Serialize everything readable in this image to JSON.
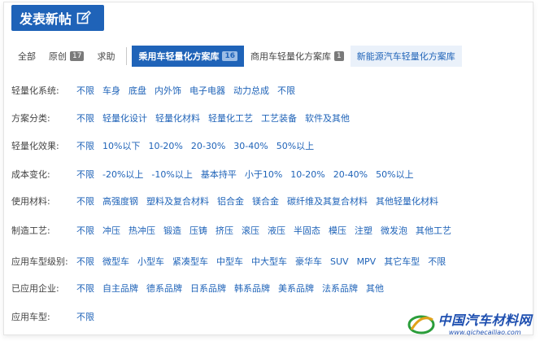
{
  "post_button": {
    "label": "发表新帖",
    "icon": "edit-icon"
  },
  "tabs": [
    {
      "label": "全部",
      "badge": "",
      "style": "plain"
    },
    {
      "label": "原创",
      "badge": "17",
      "style": "plain"
    },
    {
      "label": "求助",
      "badge": "",
      "style": "plain"
    },
    {
      "label": "乘用车轻量化方案库",
      "badge": "16",
      "style": "active"
    },
    {
      "label": "商用车轻量化方案库",
      "badge": "1",
      "style": "plain"
    },
    {
      "label": "新能源汽车轻量化方案库",
      "badge": "",
      "style": "light"
    }
  ],
  "filters": [
    {
      "label": "轻量化系统:",
      "options": [
        "不限",
        "车身",
        "底盘",
        "内外饰",
        "电子电器",
        "动力总成",
        "不限"
      ]
    },
    {
      "label": "方案分类:",
      "options": [
        "不限",
        "轻量化设计",
        "轻量化材料",
        "轻量化工艺",
        "工艺装备",
        "软件及其他"
      ]
    },
    {
      "label": "轻量化效果:",
      "options": [
        "不限",
        "10%以下",
        "10-20%",
        "20-30%",
        "30-40%",
        "50%以上"
      ]
    },
    {
      "label": "成本变化:",
      "options": [
        "不限",
        "-20%以上",
        "-10%以上",
        "基本持平",
        "小于10%",
        "10-20%",
        "20-40%",
        "50%以上"
      ]
    },
    {
      "label": "使用材料:",
      "options": [
        "不限",
        "高强度钢",
        "塑料及复合材料",
        "铝合金",
        "镁合金",
        "碳纤维及其复合材料",
        "其他轻量化材料"
      ]
    },
    {
      "label": "制造工艺:",
      "options": [
        "不限",
        "冲压",
        "热冲压",
        "锻造",
        "压铸",
        "挤压",
        "滚压",
        "液压",
        "半固态",
        "模压",
        "注塑",
        "微发泡",
        "其他工艺"
      ]
    },
    {
      "label": "应用车型级别:",
      "options": [
        "不限",
        "微型车",
        "小型车",
        "紧凑型车",
        "中型车",
        "中大型车",
        "豪华车",
        "SUV",
        "MPV",
        "其它车型",
        "不限"
      ]
    },
    {
      "label": "已应用企业:",
      "options": [
        "不限",
        "自主品牌",
        "德系品牌",
        "日系品牌",
        "韩系品牌",
        "美系品牌",
        "法系品牌",
        "其他"
      ]
    },
    {
      "label": "应用车型:",
      "options": [
        "不限"
      ]
    }
  ],
  "watermark": {
    "name": "中国汽车材料网",
    "url": "www.qichecailiao.com"
  },
  "colors": {
    "primary": "#1f63b8",
    "badge": "#7a7a7a",
    "light_tab": "#eaf1fa"
  }
}
